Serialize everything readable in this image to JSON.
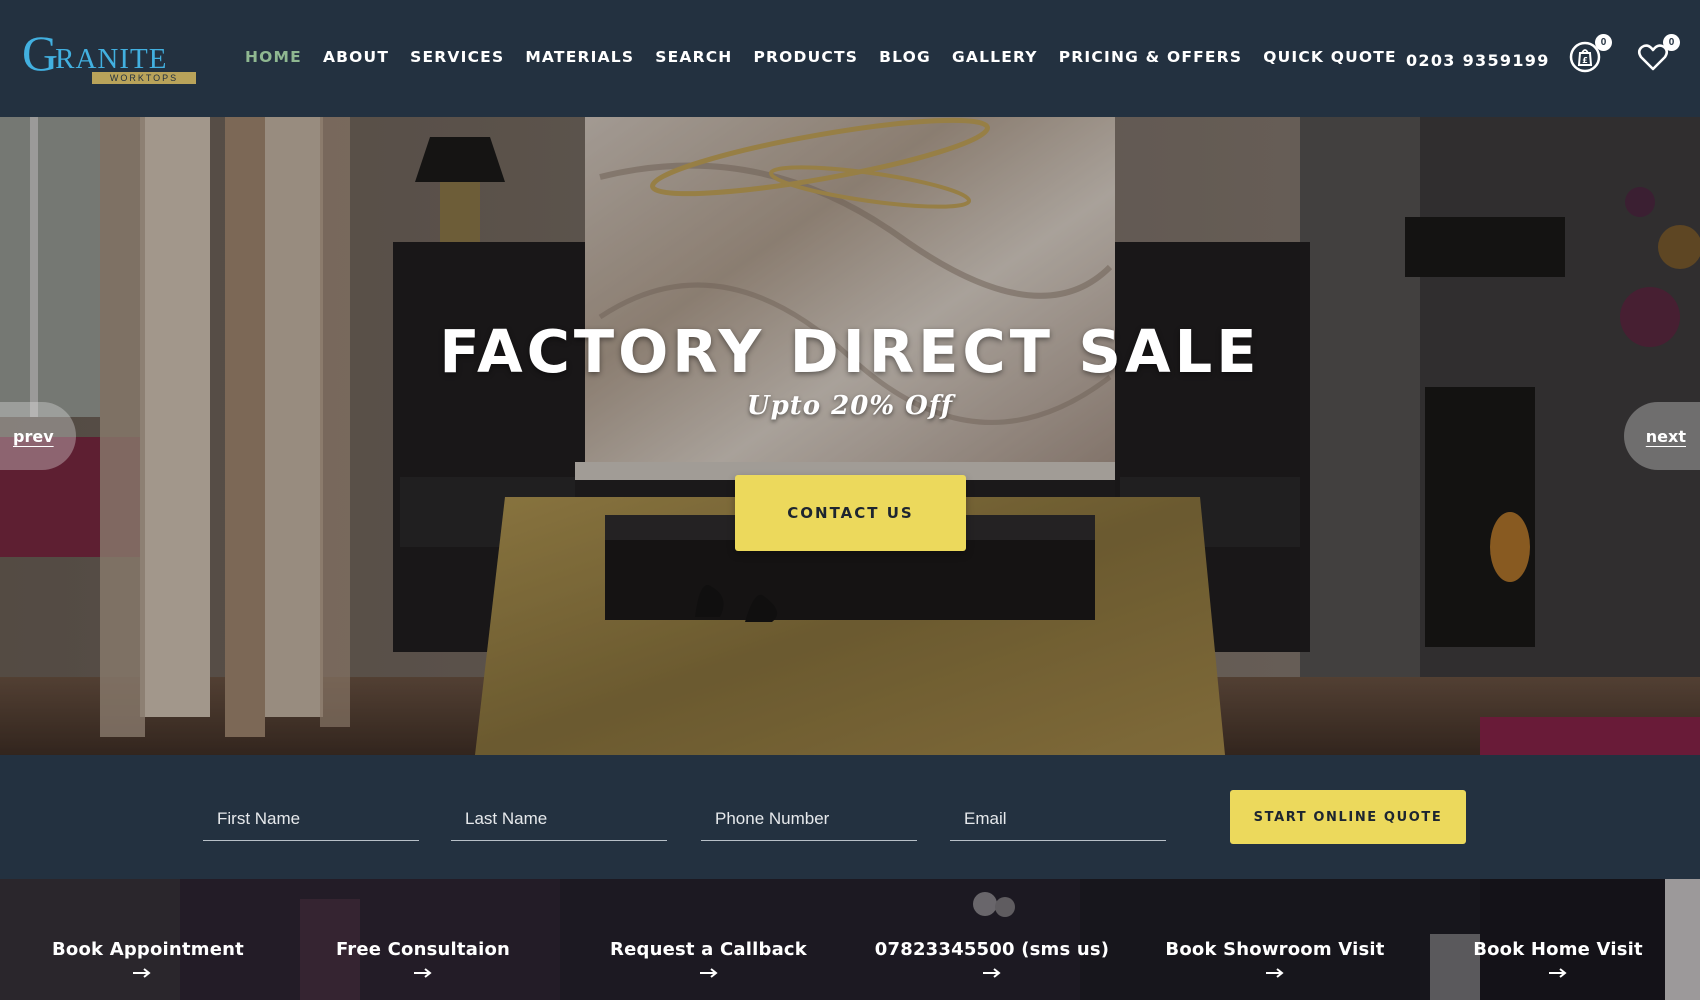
{
  "brand": {
    "logo_initial": "G",
    "logo_rest": "RANITE",
    "logo_tagline": "WORKTOPS"
  },
  "nav": [
    {
      "label": "HOME",
      "active": true
    },
    {
      "label": "ABOUT"
    },
    {
      "label": "SERVICES"
    },
    {
      "label": "MATERIALS"
    },
    {
      "label": "SEARCH"
    },
    {
      "label": "PRODUCTS"
    },
    {
      "label": "BLOG"
    },
    {
      "label": "GALLERY"
    },
    {
      "label": "PRICING & OFFERS"
    },
    {
      "label": "QUICK QUOTE"
    }
  ],
  "header": {
    "phone": "0203 9359199",
    "bag_count": "0",
    "wishlist_count": "0"
  },
  "hero": {
    "title": "FACTORY DIRECT SALE",
    "subtitle": "Upto 20% Off",
    "cta_label": "CONTACT US",
    "prev_label": "prev",
    "next_label": "next"
  },
  "quote_form": {
    "first_name_placeholder": "First Name",
    "last_name_placeholder": "Last Name",
    "phone_placeholder": "Phone Number",
    "email_placeholder": "Email",
    "submit_label": "START ONLINE QUOTE"
  },
  "actions": [
    {
      "label": "Book Appointment",
      "icon": "arrow-right-icon"
    },
    {
      "label": "Free Consultaion",
      "icon": "arrow-right-icon"
    },
    {
      "label": "Request a Callback",
      "icon": "arrow-right-icon"
    },
    {
      "label": "07823345500 (sms us)",
      "icon": "arrow-right-icon"
    },
    {
      "label": "Book Showroom Visit",
      "icon": "arrow-right-icon"
    },
    {
      "label": "Book Home Visit",
      "icon": "arrow-right-icon"
    }
  ],
  "colors": {
    "navy": "#233140",
    "accent_yellow": "#ecd95c",
    "active_nav": "#8fb891",
    "logo_blue": "#42b0e0"
  }
}
